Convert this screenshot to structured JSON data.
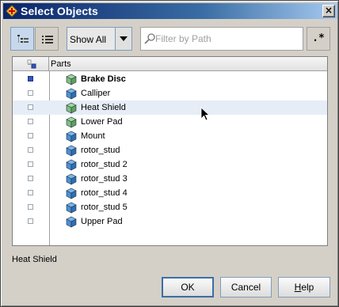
{
  "window": {
    "title": "Select Objects",
    "close_label": "×"
  },
  "toolbar": {
    "tree_view_icon": "tree-view-icon",
    "list_view_icon": "list-view-icon",
    "filter_mode_selected": "Show All",
    "filter_placeholder": "Filter by Path",
    "regex_label": ".*"
  },
  "table": {
    "columns": [
      "",
      "Parts"
    ],
    "rows": [
      {
        "label": "Brake Disc",
        "checked": true,
        "bold": true,
        "icon": "part-icon-green"
      },
      {
        "label": "Calliper",
        "checked": false,
        "bold": false,
        "icon": "part-icon-blue"
      },
      {
        "label": "Heat Shield",
        "checked": false,
        "bold": false,
        "icon": "part-icon-green",
        "highlighted": true
      },
      {
        "label": "Lower Pad",
        "checked": false,
        "bold": false,
        "icon": "part-icon-green"
      },
      {
        "label": "Mount",
        "checked": false,
        "bold": false,
        "icon": "part-icon-blue"
      },
      {
        "label": "rotor_stud",
        "checked": false,
        "bold": false,
        "icon": "part-icon-blue"
      },
      {
        "label": "rotor_stud 2",
        "checked": false,
        "bold": false,
        "icon": "part-icon-blue"
      },
      {
        "label": "rotor_stud 3",
        "checked": false,
        "bold": false,
        "icon": "part-icon-blue"
      },
      {
        "label": "rotor_stud 4",
        "checked": false,
        "bold": false,
        "icon": "part-icon-blue"
      },
      {
        "label": "rotor_stud 5",
        "checked": false,
        "bold": false,
        "icon": "part-icon-blue"
      },
      {
        "label": "Upper Pad",
        "checked": false,
        "bold": false,
        "icon": "part-icon-blue"
      }
    ]
  },
  "status": {
    "text": "Heat Shield"
  },
  "buttons": {
    "ok": "OK",
    "cancel": "Cancel",
    "help_mnemonic": "H",
    "help_rest": "elp"
  },
  "colors": {
    "titlebar": "#0a246a",
    "selection_row": "#e6edf7",
    "checked_box": "#3355bb",
    "part_green": "#7fbf7f",
    "part_blue": "#4a90d9"
  }
}
